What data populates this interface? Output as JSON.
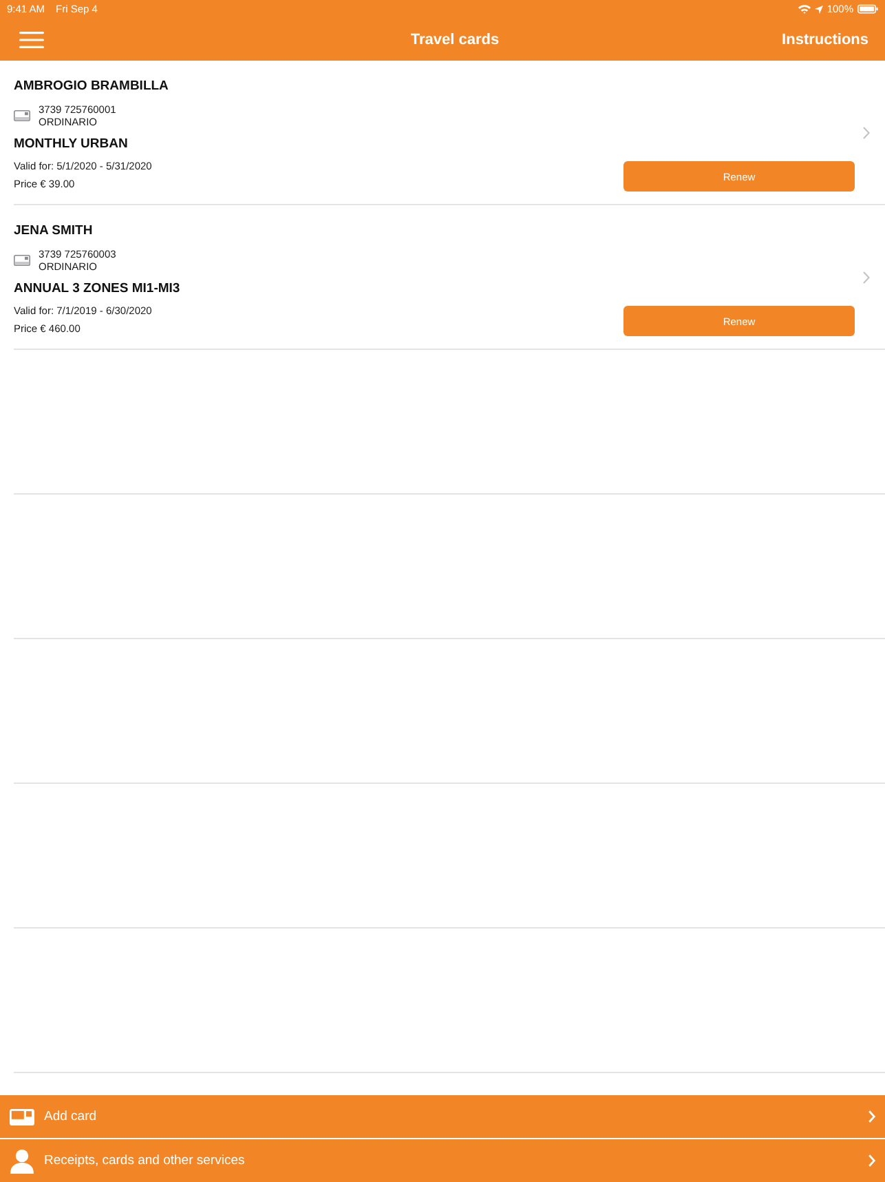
{
  "status_bar": {
    "time": "9:41 AM",
    "date": "Fri Sep 4",
    "battery": "100%"
  },
  "nav_bar": {
    "title": "Travel cards",
    "action": "Instructions"
  },
  "cards": [
    {
      "holder": "AMBROGIO BRAMBILLA",
      "card_number": "3739 725760001",
      "card_type": "ORDINARIO",
      "product": "MONTHLY URBAN",
      "validity": "Valid for: 5/1/2020 - 5/31/2020",
      "price": "Price € 39.00",
      "button": "Renew"
    },
    {
      "holder": "JENA SMITH",
      "card_number": "3739 725760003",
      "card_type": "ORDINARIO",
      "product": "ANNUAL 3 ZONES MI1-MI3",
      "validity": "Valid for: 7/1/2019 - 6/30/2020",
      "price": "Price € 460.00",
      "button": "Renew"
    }
  ],
  "bottom_actions": [
    {
      "kind": "card",
      "label": "Add card"
    },
    {
      "kind": "person",
      "label": "Receipts, cards and other services"
    }
  ]
}
